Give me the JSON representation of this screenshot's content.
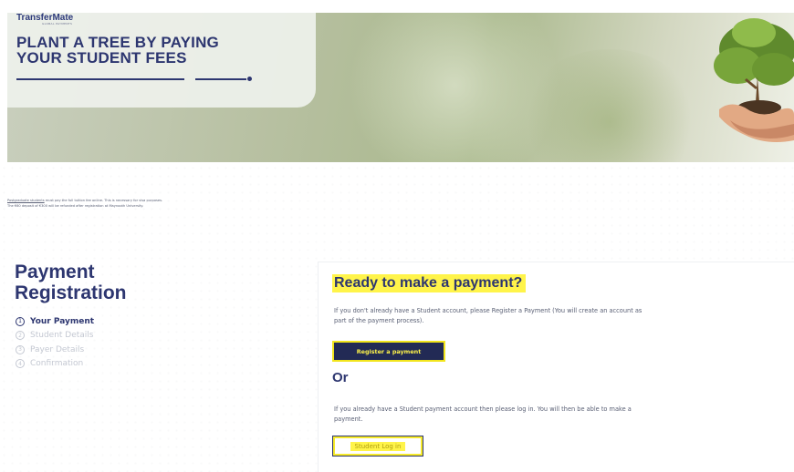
{
  "hero": {
    "brand": "TransferMate",
    "brand_sub": "GLOBAL PAYMENTS",
    "title_line1": "PLANT A TREE BY PAYING",
    "title_line2": "YOUR STUDENT FEES"
  },
  "note": {
    "line1_link": "Postgraduate students",
    "line1_rest": " must pay the full tuition fee online. This is necessary for visa purposes.",
    "line2": "The €60 deposit of €300 will be refunded after registration at Maynooth University."
  },
  "sidebar": {
    "title_line1": "Payment",
    "title_line2": "Registration",
    "steps": [
      {
        "num": "1",
        "label": "Your Payment"
      },
      {
        "num": "2",
        "label": "Student Details"
      },
      {
        "num": "3",
        "label": "Payer Details"
      },
      {
        "num": "4",
        "label": "Confirmation"
      }
    ]
  },
  "main": {
    "heading": "Ready to make a payment?",
    "register_text_line1": "If you don't already have a Student account, please Register a Payment (You will create an account as",
    "register_text_line2": "part of the payment process).",
    "register_button": "Register a payment",
    "or_label": "Or",
    "login_text_line1": "If you already have a Student payment account then please log in. You will then be able to make a",
    "login_text_line2": "payment.",
    "login_button": "Student Log in"
  },
  "colors": {
    "navy": "#2d3670",
    "highlight": "#fff44a",
    "button_dark": "#222a55"
  }
}
